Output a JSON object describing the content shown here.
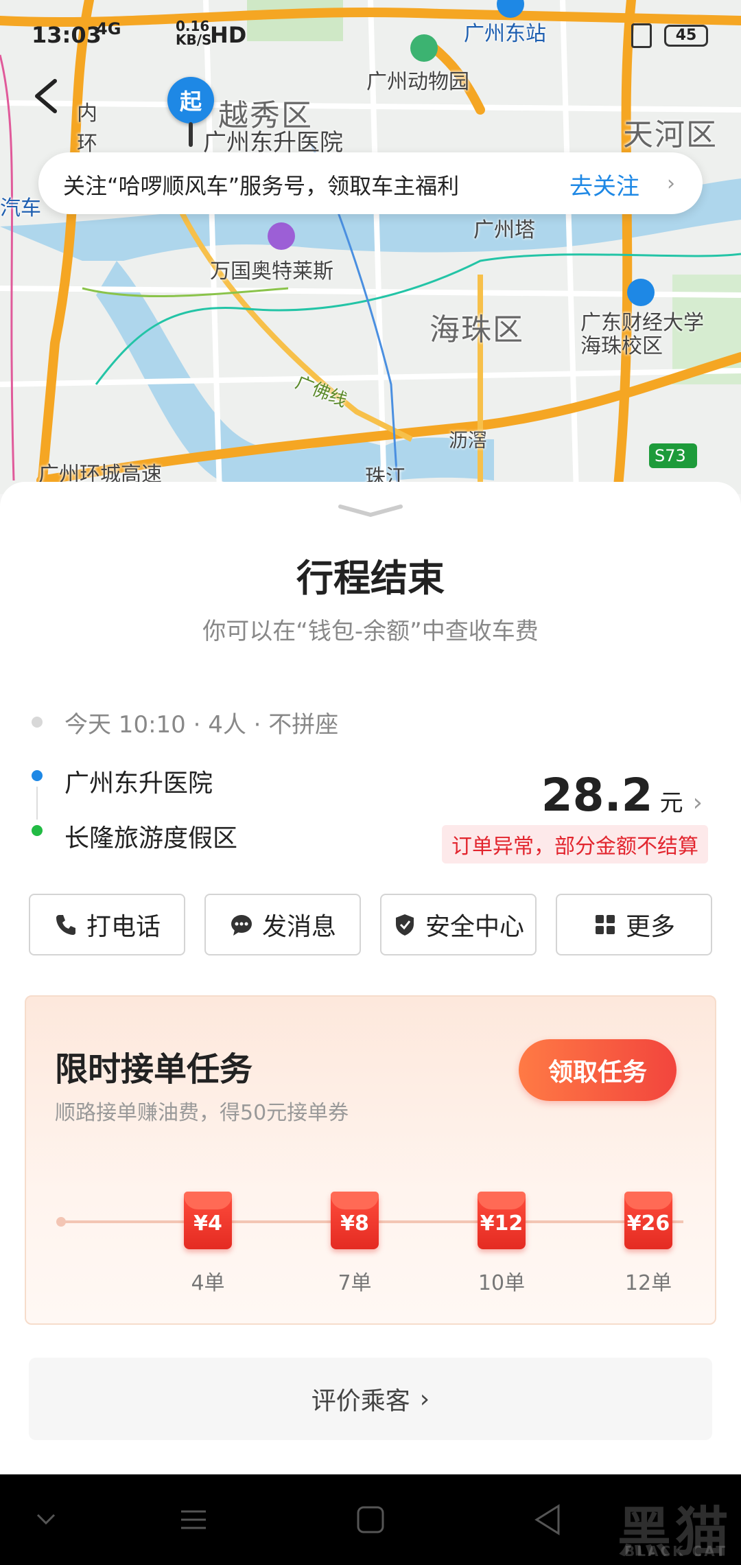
{
  "status_bar": {
    "time": "13:03",
    "network": "4G",
    "speed": "0.16 KB/S",
    "hd": "HD",
    "battery": "45"
  },
  "map": {
    "labels": {
      "guangzhou_east_station": "广州东站",
      "zoo": "广州动物园",
      "yuexiu": "越秀区",
      "tianhe": "天河区",
      "hospital": "广州东升医院",
      "inner_ring": "内环",
      "canton_tower": "广州塔",
      "outlets": "万国奥特莱斯",
      "haizhu": "海珠区",
      "university": "广东财经大学海珠校区",
      "foshan_line": "广佛线",
      "lijiao": "沥滘",
      "ring_expressway": "广州环城高速",
      "zhujiang": "珠江",
      "s73": "S73",
      "qiche": "汽车"
    },
    "start_pin": "起"
  },
  "notice": {
    "text": "关注“哈啰顺风车”服务号，领取车主福利",
    "action": "去关注"
  },
  "trip": {
    "title": "行程结束",
    "subtitle": "你可以在“钱包-余额”中查收车费",
    "meta": "今天 10:10 · 4人 · 不拼座",
    "from": "广州东升医院",
    "to": "长隆旅游度假区",
    "price": "28.2",
    "unit": "元",
    "warning": "订单异常，部分金额不结算"
  },
  "actions": {
    "call": "打电话",
    "message": "发消息",
    "safety": "安全中心",
    "more": "更多"
  },
  "task": {
    "title": "限时接单任务",
    "desc": "顺路接单赚油费，得50元接单券",
    "claim": "领取任务",
    "steps": [
      {
        "reward": "¥4",
        "orders": "4单"
      },
      {
        "reward": "¥8",
        "orders": "7单"
      },
      {
        "reward": "¥12",
        "orders": "10单"
      },
      {
        "reward": "¥26",
        "orders": "12单"
      }
    ]
  },
  "rate": {
    "label": "评价乘客"
  },
  "watermark": {
    "text": "黑猫",
    "sub": "BLACK CAT"
  },
  "colors": {
    "accent": "#1e88e5",
    "danger": "#e2252e",
    "claim": "#f2453d"
  }
}
